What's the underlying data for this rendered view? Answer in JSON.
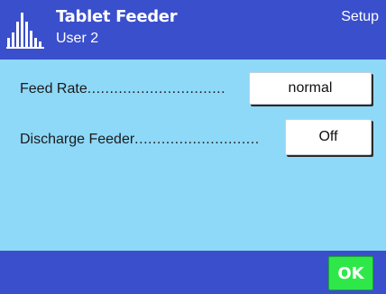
{
  "header": {
    "title": "Tablet Feeder",
    "subtitle": "User 2",
    "mode": "Setup",
    "icon": "balance-bars-icon"
  },
  "settings": [
    {
      "label": "Feed Rate",
      "dots": "...............................",
      "value": "normal"
    },
    {
      "label": "Discharge Feeder",
      "dots": "............................",
      "value": "Off"
    }
  ],
  "footer": {
    "ok_label": "OK"
  },
  "colors": {
    "header_bg": "#3a4fcc",
    "body_bg": "#8ed8f8",
    "ok_bg": "#2ee84a"
  }
}
